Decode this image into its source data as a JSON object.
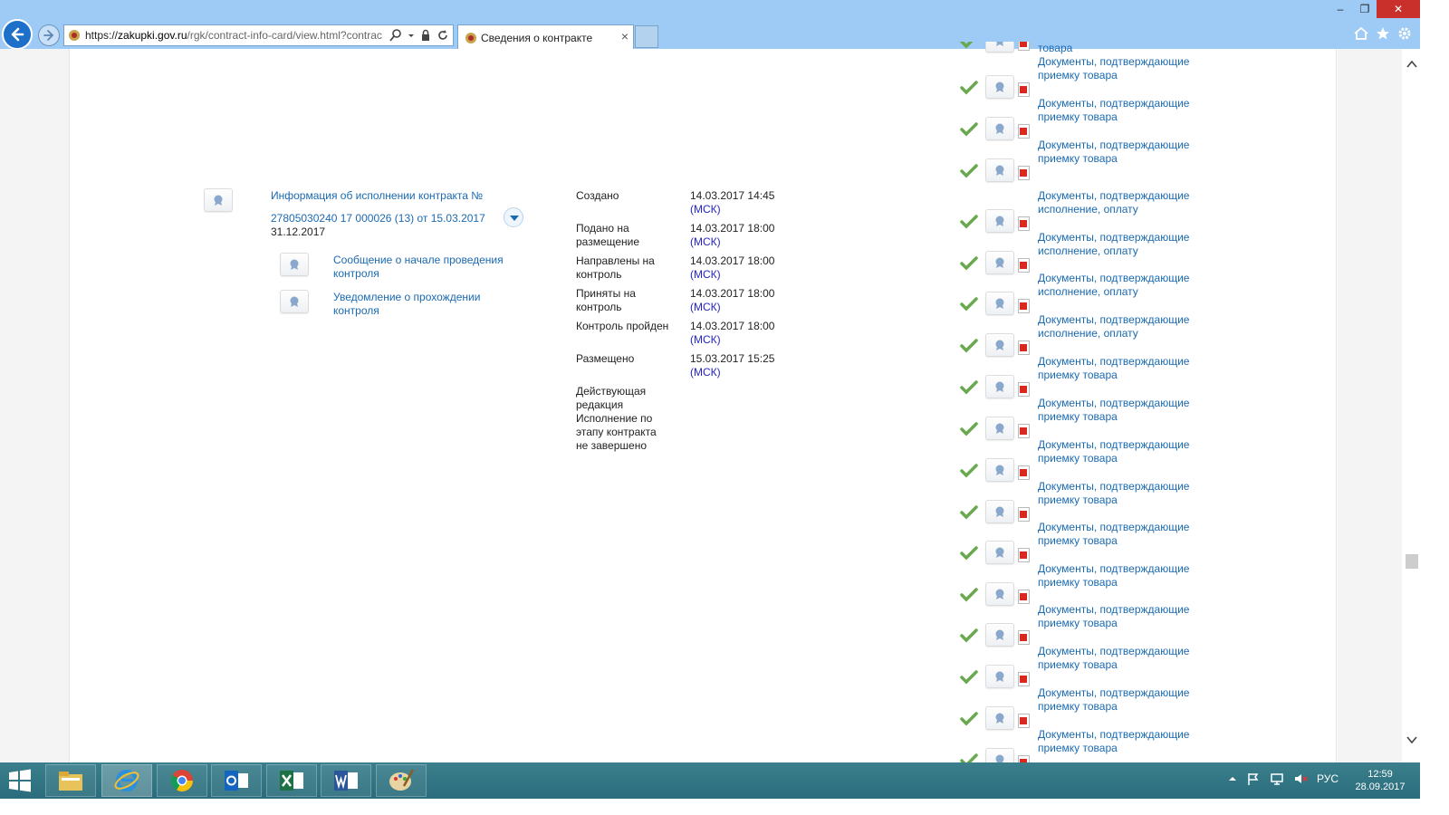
{
  "browser": {
    "url_prefix": "https://",
    "url_domain": "zakupki.gov.ru",
    "url_path": "/rgk/contract-info-card/view.html?contrac",
    "tab_title": "Сведения о контракте",
    "tab_close": "×"
  },
  "window": {
    "minimize": "–",
    "restore": "❐",
    "close": "✕"
  },
  "record": {
    "title_line1": "Информация об исполнении контракта №",
    "title_line2": "27805030240 17 000026 (13) от 15.03.2017",
    "date": "31.12.2017",
    "subitems": [
      {
        "label": "Сообщение о начале проведения контроля"
      },
      {
        "label": "Уведомление о прохождении контроля"
      }
    ]
  },
  "status": [
    {
      "label": "Создано",
      "value": "14.03.2017 14:45",
      "tz": "(МСК)"
    },
    {
      "label": "Подано на размещение",
      "value": "14.03.2017 18:00",
      "tz": "(МСК)"
    },
    {
      "label": "Направлены на контроль",
      "value": "14.03.2017 18:00",
      "tz": "(МСК)"
    },
    {
      "label": "Приняты на контроль",
      "value": "14.03.2017 18:00",
      "tz": "(МСК)"
    },
    {
      "label": "Контроль пройден",
      "value": "14.03.2017 18:00",
      "tz": "(МСК)"
    },
    {
      "label": "Размещено",
      "value": "15.03.2017 15:25",
      "tz": "(МСК)"
    }
  ],
  "status_note": "Действующая редакция Исполнение по этапу контракта не завершено",
  "docs": [
    {
      "label": "товара"
    },
    {
      "label": "Документы, подтверждающие приемку товара"
    },
    {
      "label": "Документы, подтверждающие приемку товара"
    },
    {
      "label": "Документы, подтверждающие приемку товара"
    },
    {
      "label": "Документы, подтверждающие исполнение, оплату"
    },
    {
      "label": "Документы, подтверждающие исполнение, оплату"
    },
    {
      "label": "Документы, подтверждающие исполнение, оплату"
    },
    {
      "label": "Документы, подтверждающие исполнение, оплату"
    },
    {
      "label": "Документы, подтверждающие приемку товара"
    },
    {
      "label": "Документы, подтверждающие приемку товара"
    },
    {
      "label": "Документы, подтверждающие приемку товара"
    },
    {
      "label": "Документы, подтверждающие приемку товара"
    },
    {
      "label": "Документы, подтверждающие приемку товара"
    },
    {
      "label": "Документы, подтверждающие приемку товара"
    },
    {
      "label": "Документы, подтверждающие приемку товара"
    },
    {
      "label": "Документы, подтверждающие приемку товара"
    },
    {
      "label": "Документы, подтверждающие приемку товара"
    },
    {
      "label": "Документы, подтверждающие приемку товара"
    }
  ],
  "taskbar": {
    "lang": "РУС",
    "time": "12:59",
    "date": "28.09.2017"
  }
}
